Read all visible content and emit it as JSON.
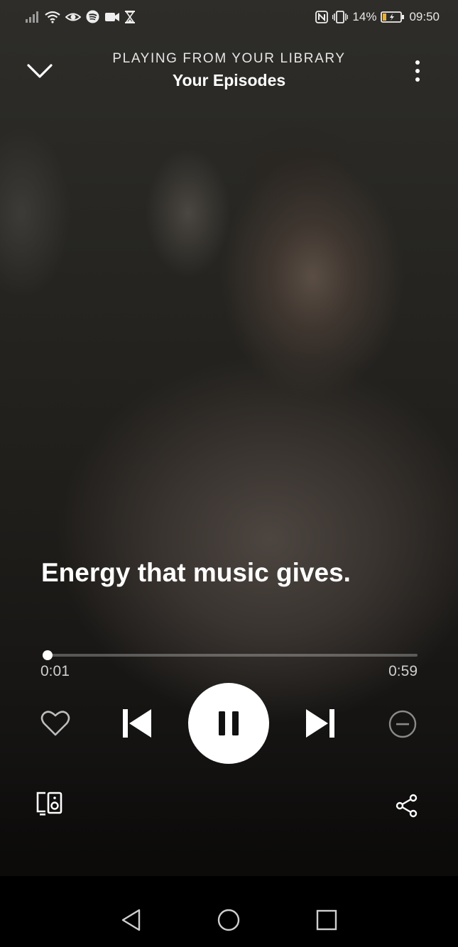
{
  "status_bar": {
    "battery_percent": "14%",
    "time": "09:50",
    "left_icons": [
      "signal-icon",
      "wifi-icon",
      "eye-icon",
      "spotify-icon",
      "video-camera-icon",
      "hourglass-icon"
    ],
    "right_icons": [
      "nfc-icon",
      "vibrate-icon",
      "battery-icon"
    ]
  },
  "header": {
    "context_label": "PLAYING FROM YOUR LIBRARY",
    "title": "Your Episodes",
    "icons": [
      "chevron-down-icon",
      "more-vertical-icon"
    ]
  },
  "caption": {
    "text": "Energy that music gives."
  },
  "playback": {
    "elapsed": "0:01",
    "duration": "0:59",
    "progress_fraction": 0.014,
    "is_playing": true
  },
  "controls": {
    "icons": [
      "heart-icon",
      "skip-previous-icon",
      "pause-icon",
      "skip-next-icon",
      "hide-minus-icon",
      "devices-icon",
      "share-icon"
    ]
  },
  "system_nav": {
    "icons": [
      "back-triangle-icon",
      "home-circle-icon",
      "recents-square-icon"
    ]
  },
  "colors": {
    "accent": "#ffffff",
    "muted_text": "#cfcfcf",
    "track_bg": "rgba(255,255,255,0.28)",
    "battery_fill": "#e8b23a"
  }
}
